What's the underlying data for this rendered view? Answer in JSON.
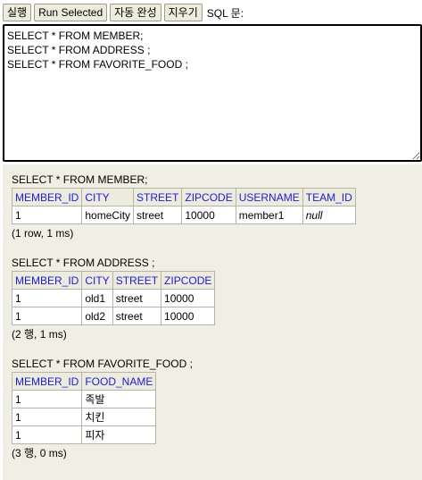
{
  "toolbar": {
    "run_label": "실행",
    "run_selected_label": "Run Selected",
    "autocomplete_label": "자동 완성",
    "clear_label": "지우기",
    "sql_label": "SQL 문:"
  },
  "editor": {
    "text": "SELECT * FROM MEMBER;\nSELECT * FROM ADDRESS ;\nSELECT * FROM FAVORITE_FOOD ;"
  },
  "results": [
    {
      "statement": "SELECT * FROM MEMBER;",
      "columns": [
        "MEMBER_ID",
        "CITY",
        "STREET",
        "ZIPCODE",
        "USERNAME",
        "TEAM_ID"
      ],
      "rows": [
        [
          "1",
          "homeCity",
          "street",
          "10000",
          "member1",
          "null"
        ]
      ],
      "summary": "(1 row, 1 ms)"
    },
    {
      "statement": "SELECT * FROM ADDRESS ;",
      "columns": [
        "MEMBER_ID",
        "CITY",
        "STREET",
        "ZIPCODE"
      ],
      "rows": [
        [
          "1",
          "old1",
          "street",
          "10000"
        ],
        [
          "1",
          "old2",
          "street",
          "10000"
        ]
      ],
      "summary": "(2 행, 1 ms)"
    },
    {
      "statement": "SELECT * FROM FAVORITE_FOOD ;",
      "columns": [
        "MEMBER_ID",
        "FOOD_NAME"
      ],
      "rows": [
        [
          "1",
          "족발"
        ],
        [
          "1",
          "치킨"
        ],
        [
          "1",
          "피자"
        ]
      ],
      "summary": "(3 행, 0 ms)"
    }
  ],
  "colors": {
    "header_text": "#1a1aee",
    "results_background": "#f0efe3",
    "button_background": "#ecebdc"
  }
}
